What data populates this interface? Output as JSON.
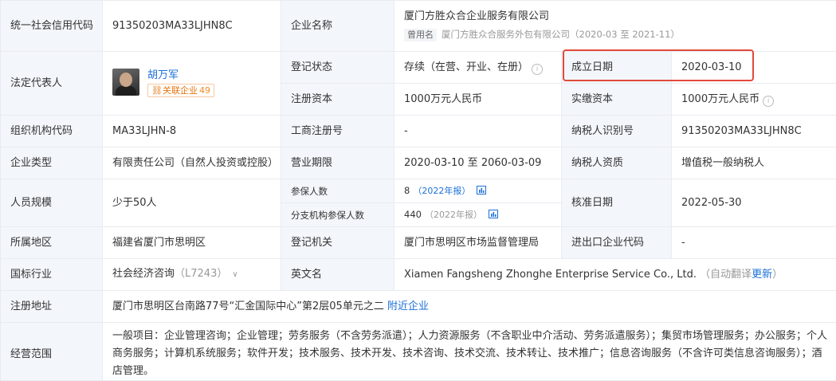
{
  "colors": {
    "label_bg": "#f3f6fb",
    "link": "#1b6fd8",
    "highlight": "#e34a3c",
    "badge_orange": "#e8740c"
  },
  "rows": {
    "credit_code": {
      "label": "统一社会信用代码",
      "value": "91350203MA33LJHN8C"
    },
    "company_name": {
      "label": "企业名称",
      "value": "厦门方胜众合企业服务有限公司",
      "former_tag": "曾用名",
      "former_name": "厦门方胜众合服务外包有限公司（2020-03 至 2021-11）"
    },
    "legal_rep": {
      "label": "法定代表人",
      "name": "胡万军",
      "related_label": "关联企业",
      "related_count": "49"
    },
    "reg_status": {
      "label": "登记状态",
      "value": "存续（在营、开业、在册）"
    },
    "found_date": {
      "label": "成立日期",
      "value": "2020-03-10"
    },
    "reg_capital": {
      "label": "注册资本",
      "value": "1000万元人民币"
    },
    "paid_capital": {
      "label": "实缴资本",
      "value": "1000万元人民币"
    },
    "org_code": {
      "label": "组织机构代码",
      "value": "MA33LJHN-8"
    },
    "biz_reg_no": {
      "label": "工商注册号",
      "value": "-"
    },
    "taxpayer_id": {
      "label": "纳税人识别号",
      "value": "91350203MA33LJHN8C"
    },
    "company_type": {
      "label": "企业类型",
      "value": "有限责任公司（自然人投资或控股）"
    },
    "biz_term": {
      "label": "营业期限",
      "value": "2020-03-10 至 2060-03-09"
    },
    "taxpayer_qual": {
      "label": "纳税人资质",
      "value": "增值税一般纳税人"
    },
    "staff_size": {
      "label": "人员规模",
      "value": "少于50人"
    },
    "insured": {
      "label": "参保人数",
      "value": "8",
      "year": "（2022年报）"
    },
    "branch_insured": {
      "label": "分支机构参保人数",
      "value": "440",
      "year": "（2022年报）"
    },
    "approve_date": {
      "label": "核准日期",
      "value": "2022-05-30"
    },
    "region": {
      "label": "所属地区",
      "value": "福建省厦门市思明区"
    },
    "reg_authority": {
      "label": "登记机关",
      "value": "厦门市思明区市场监督管理局"
    },
    "import_export": {
      "label": "进出口企业代码",
      "value": "-"
    },
    "industry": {
      "label": "国标行业",
      "value": "社会经济咨询",
      "code": "（L7243）"
    },
    "english_name": {
      "label": "英文名",
      "value": "Xiamen Fangsheng Zhonghe Enterprise Service Co., Ltd.",
      "auto_note": "（自动翻译",
      "update_link": "更新",
      "close": "）"
    },
    "address": {
      "label": "注册地址",
      "value": "厦门市思明区台南路77号“汇金国际中心”第2层05单元之二",
      "nearby_link": "附近企业"
    },
    "scope": {
      "label": "经营范围",
      "value": "一般项目：企业管理咨询；企业管理；劳务服务（不含劳务派遣）；人力资源服务（不含职业中介活动、劳务派遣服务）；集贸市场管理服务；办公服务；个人商务服务；计算机系统服务；软件开发；技术服务、技术开发、技术咨询、技术交流、技术转让、技术推广；信息咨询服务（不含许可类信息咨询服务）；酒店管理。"
    }
  }
}
